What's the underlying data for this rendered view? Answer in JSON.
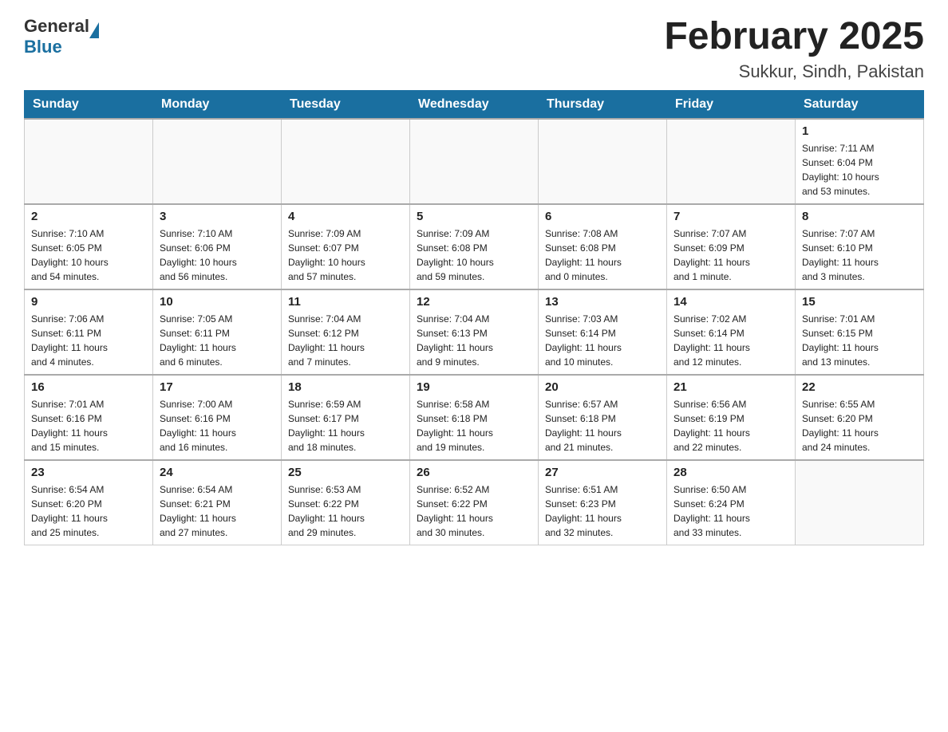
{
  "header": {
    "title": "February 2025",
    "subtitle": "Sukkur, Sindh, Pakistan",
    "logo_general": "General",
    "logo_blue": "Blue"
  },
  "columns": [
    "Sunday",
    "Monday",
    "Tuesday",
    "Wednesday",
    "Thursday",
    "Friday",
    "Saturday"
  ],
  "weeks": [
    [
      {
        "day": "",
        "info": ""
      },
      {
        "day": "",
        "info": ""
      },
      {
        "day": "",
        "info": ""
      },
      {
        "day": "",
        "info": ""
      },
      {
        "day": "",
        "info": ""
      },
      {
        "day": "",
        "info": ""
      },
      {
        "day": "1",
        "info": "Sunrise: 7:11 AM\nSunset: 6:04 PM\nDaylight: 10 hours\nand 53 minutes."
      }
    ],
    [
      {
        "day": "2",
        "info": "Sunrise: 7:10 AM\nSunset: 6:05 PM\nDaylight: 10 hours\nand 54 minutes."
      },
      {
        "day": "3",
        "info": "Sunrise: 7:10 AM\nSunset: 6:06 PM\nDaylight: 10 hours\nand 56 minutes."
      },
      {
        "day": "4",
        "info": "Sunrise: 7:09 AM\nSunset: 6:07 PM\nDaylight: 10 hours\nand 57 minutes."
      },
      {
        "day": "5",
        "info": "Sunrise: 7:09 AM\nSunset: 6:08 PM\nDaylight: 10 hours\nand 59 minutes."
      },
      {
        "day": "6",
        "info": "Sunrise: 7:08 AM\nSunset: 6:08 PM\nDaylight: 11 hours\nand 0 minutes."
      },
      {
        "day": "7",
        "info": "Sunrise: 7:07 AM\nSunset: 6:09 PM\nDaylight: 11 hours\nand 1 minute."
      },
      {
        "day": "8",
        "info": "Sunrise: 7:07 AM\nSunset: 6:10 PM\nDaylight: 11 hours\nand 3 minutes."
      }
    ],
    [
      {
        "day": "9",
        "info": "Sunrise: 7:06 AM\nSunset: 6:11 PM\nDaylight: 11 hours\nand 4 minutes."
      },
      {
        "day": "10",
        "info": "Sunrise: 7:05 AM\nSunset: 6:11 PM\nDaylight: 11 hours\nand 6 minutes."
      },
      {
        "day": "11",
        "info": "Sunrise: 7:04 AM\nSunset: 6:12 PM\nDaylight: 11 hours\nand 7 minutes."
      },
      {
        "day": "12",
        "info": "Sunrise: 7:04 AM\nSunset: 6:13 PM\nDaylight: 11 hours\nand 9 minutes."
      },
      {
        "day": "13",
        "info": "Sunrise: 7:03 AM\nSunset: 6:14 PM\nDaylight: 11 hours\nand 10 minutes."
      },
      {
        "day": "14",
        "info": "Sunrise: 7:02 AM\nSunset: 6:14 PM\nDaylight: 11 hours\nand 12 minutes."
      },
      {
        "day": "15",
        "info": "Sunrise: 7:01 AM\nSunset: 6:15 PM\nDaylight: 11 hours\nand 13 minutes."
      }
    ],
    [
      {
        "day": "16",
        "info": "Sunrise: 7:01 AM\nSunset: 6:16 PM\nDaylight: 11 hours\nand 15 minutes."
      },
      {
        "day": "17",
        "info": "Sunrise: 7:00 AM\nSunset: 6:16 PM\nDaylight: 11 hours\nand 16 minutes."
      },
      {
        "day": "18",
        "info": "Sunrise: 6:59 AM\nSunset: 6:17 PM\nDaylight: 11 hours\nand 18 minutes."
      },
      {
        "day": "19",
        "info": "Sunrise: 6:58 AM\nSunset: 6:18 PM\nDaylight: 11 hours\nand 19 minutes."
      },
      {
        "day": "20",
        "info": "Sunrise: 6:57 AM\nSunset: 6:18 PM\nDaylight: 11 hours\nand 21 minutes."
      },
      {
        "day": "21",
        "info": "Sunrise: 6:56 AM\nSunset: 6:19 PM\nDaylight: 11 hours\nand 22 minutes."
      },
      {
        "day": "22",
        "info": "Sunrise: 6:55 AM\nSunset: 6:20 PM\nDaylight: 11 hours\nand 24 minutes."
      }
    ],
    [
      {
        "day": "23",
        "info": "Sunrise: 6:54 AM\nSunset: 6:20 PM\nDaylight: 11 hours\nand 25 minutes."
      },
      {
        "day": "24",
        "info": "Sunrise: 6:54 AM\nSunset: 6:21 PM\nDaylight: 11 hours\nand 27 minutes."
      },
      {
        "day": "25",
        "info": "Sunrise: 6:53 AM\nSunset: 6:22 PM\nDaylight: 11 hours\nand 29 minutes."
      },
      {
        "day": "26",
        "info": "Sunrise: 6:52 AM\nSunset: 6:22 PM\nDaylight: 11 hours\nand 30 minutes."
      },
      {
        "day": "27",
        "info": "Sunrise: 6:51 AM\nSunset: 6:23 PM\nDaylight: 11 hours\nand 32 minutes."
      },
      {
        "day": "28",
        "info": "Sunrise: 6:50 AM\nSunset: 6:24 PM\nDaylight: 11 hours\nand 33 minutes."
      },
      {
        "day": "",
        "info": ""
      }
    ]
  ]
}
